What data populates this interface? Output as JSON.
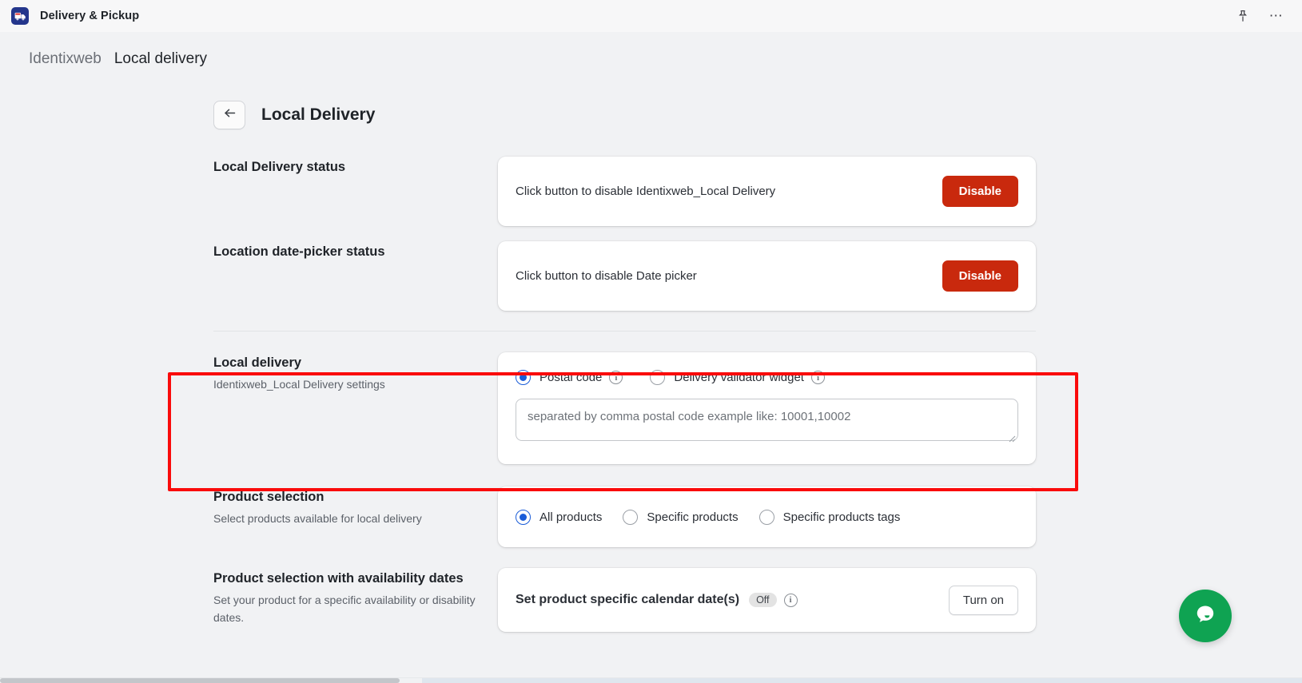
{
  "appbar": {
    "icon": "delivery-truck-icon",
    "title": "Delivery & Pickup",
    "pin_icon": "pin-icon",
    "more_icon": "more-horizontal-icon"
  },
  "breadcrumb": {
    "parent": "Identixweb",
    "current": "Local delivery"
  },
  "header": {
    "back_icon": "arrow-left-icon",
    "title": "Local Delivery"
  },
  "sections": {
    "status": {
      "title": "Local Delivery status",
      "card_text": "Click button to disable Identixweb_Local Delivery",
      "button": "Disable"
    },
    "datepicker": {
      "title": "Location date-picker status",
      "card_text": "Click button to disable Date picker",
      "button": "Disable"
    },
    "local_delivery": {
      "title": "Local delivery",
      "subtitle": "Identixweb_Local Delivery settings",
      "options": [
        {
          "label": "Postal code",
          "checked": true,
          "info": "info-icon"
        },
        {
          "label": "Delivery validator widget",
          "checked": false,
          "info": "info-icon"
        }
      ],
      "textarea_value": "",
      "textarea_placeholder": "separated by comma postal code example like: 10001,10002"
    },
    "product_selection": {
      "title": "Product selection",
      "subtitle": "Select products available for local delivery",
      "options": [
        {
          "label": "All products",
          "checked": true
        },
        {
          "label": "Specific products",
          "checked": false
        },
        {
          "label": "Specific products tags",
          "checked": false
        }
      ]
    },
    "availability_dates": {
      "title": "Product selection with availability dates",
      "subtitle": "Set your product for a specific availability or disability dates.",
      "card_text": "Set product specific calendar date(s)",
      "badge": "Off",
      "info": "info-icon",
      "button": "Turn on"
    }
  },
  "chat": {
    "icon": "chat-bubble-icon"
  },
  "colors": {
    "danger": "#c9290d",
    "accent_radio": "#1a5cd8",
    "highlight": "#fa0b0b",
    "chat_green": "#0fa352",
    "page_bg": "#f1f2f4"
  }
}
